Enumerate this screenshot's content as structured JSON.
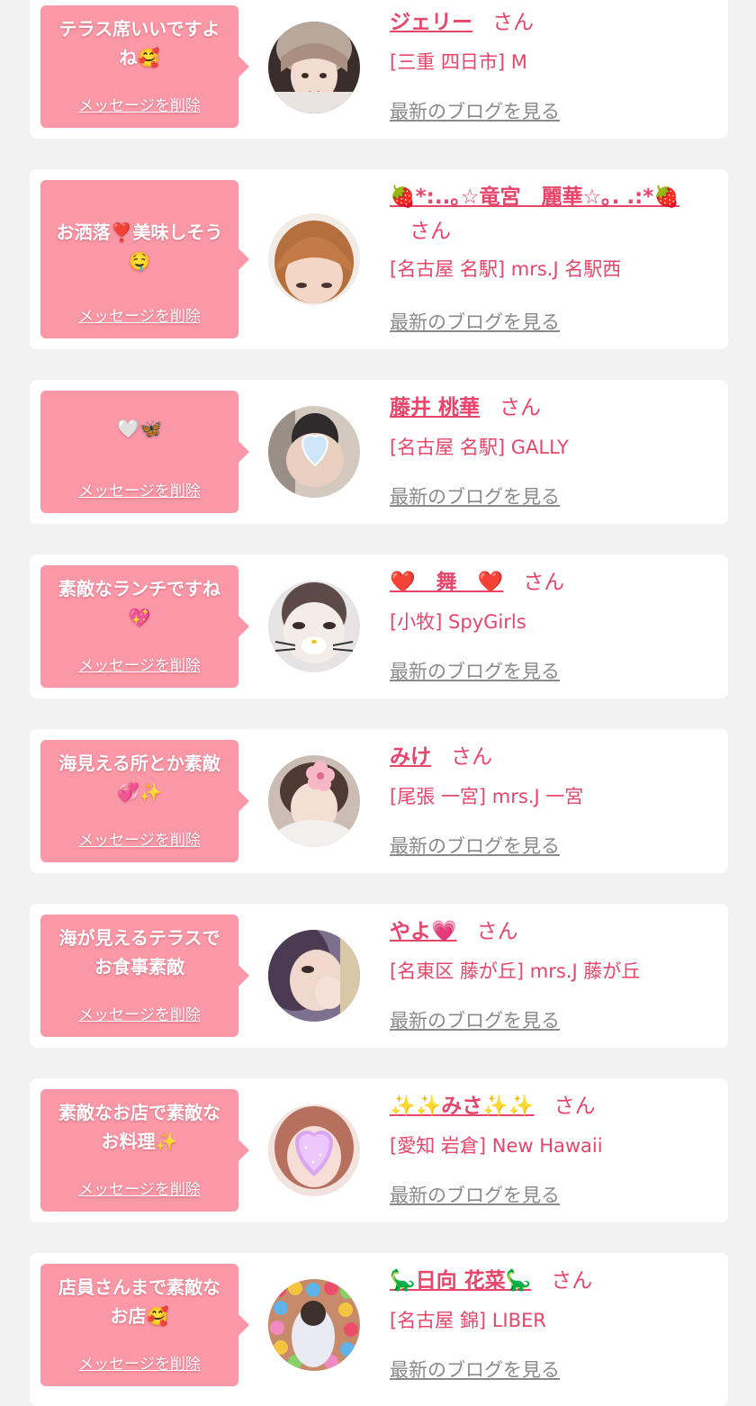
{
  "delete_label": "メッセージを削除",
  "blog_label": "最新のブログを見る",
  "san_label": "さん",
  "colors": {
    "page_bg": "#f2f2f2",
    "bubble": "#fb98a7",
    "accent": "#e8456a",
    "link_gray": "#8a8a8a"
  },
  "messages": [
    {
      "text": "テラス席いいですよね🥰",
      "name": "ジェリー",
      "location": "[三重 四日市] M"
    },
    {
      "text": "お洒落❣️美味しそう🤤",
      "name": "🍓*:..｡☆竜宮　麗華☆｡. .:*🍓",
      "location": "[名古屋 名駅] mrs.J 名駅西"
    },
    {
      "text": "🤍🦋",
      "name": "藤井 桃華",
      "location": "[名古屋 名駅] GALLY"
    },
    {
      "text": "素敵なランチですね💖",
      "name": "❤️　舞　❤️",
      "location": "[小牧] SpyGirls"
    },
    {
      "text": "海見える所とか素敵💞✨",
      "name": "みけ",
      "location": "[尾張 一宮] mrs.J 一宮"
    },
    {
      "text": "海が見えるテラスでお食事素敵",
      "name": "やよ💗",
      "location": "[名東区 藤が丘] mrs.J 藤が丘"
    },
    {
      "text": "素敵なお店で素敵なお料理✨",
      "name": "✨✨みさ✨✨",
      "location": "[愛知 岩倉] New Hawaii"
    },
    {
      "text": "店員さんまで素敵なお店🥰",
      "name": "🦕日向 花菜🦕",
      "location": "[名古屋 錦] LIBER"
    }
  ]
}
